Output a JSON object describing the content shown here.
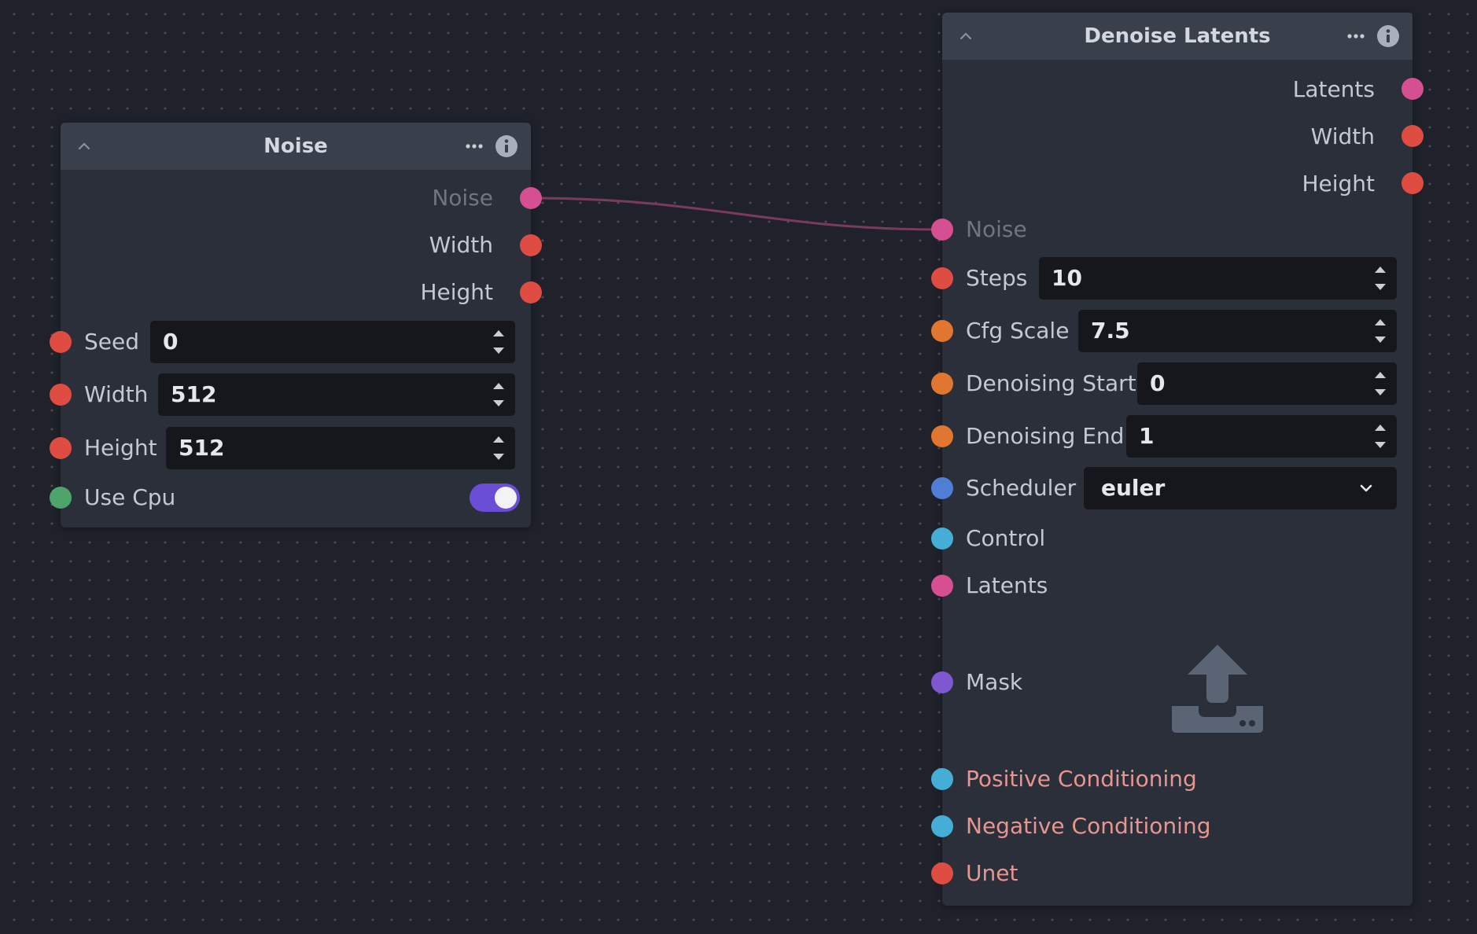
{
  "colors": {
    "canvas": "#1f222a",
    "node_body": "#2b2f3a",
    "node_header": "#3a3f4c",
    "input_bg": "#15171d",
    "edge": "#7a3a5e",
    "latents": "#d64f93",
    "integer": "#df4c42",
    "float": "#e0762f",
    "enum": "#4f7fd4",
    "conditioning": "#44aed6",
    "mask": "#7e57d1",
    "boolean": "#4ea46b",
    "toggle_on": "#6a4fd6"
  },
  "noise_node": {
    "title": "Noise",
    "outputs": {
      "noise": "Noise",
      "width": "Width",
      "height": "Height"
    },
    "inputs": {
      "seed": {
        "label": "Seed",
        "value": "0"
      },
      "width": {
        "label": "Width",
        "value": "512"
      },
      "height": {
        "label": "Height",
        "value": "512"
      },
      "use_cpu": {
        "label": "Use Cpu",
        "value": true
      }
    }
  },
  "denoise_node": {
    "title": "Denoise Latents",
    "outputs": {
      "latents": "Latents",
      "width": "Width",
      "height": "Height"
    },
    "inputs": {
      "noise": "Noise",
      "steps": {
        "label": "Steps",
        "value": "10"
      },
      "cfg_scale": {
        "label": "Cfg Scale",
        "value": "7.5"
      },
      "denoising_start": {
        "label": "Denoising Start",
        "value": "0"
      },
      "denoising_end": {
        "label": "Denoising End",
        "value": "1"
      },
      "scheduler": {
        "label": "Scheduler",
        "value": "euler"
      },
      "control": "Control",
      "latents": "Latents",
      "mask": "Mask",
      "positive_conditioning": "Positive Conditioning",
      "negative_conditioning": "Negative Conditioning",
      "unet": "Unet"
    }
  },
  "icons": {
    "collapse": "chevron-up-icon",
    "menu": "more-horizontal-icon",
    "info": "info-icon",
    "step_up": "triangle-up-icon",
    "step_down": "triangle-down-icon",
    "select": "chevron-down-icon",
    "upload": "upload-icon"
  }
}
